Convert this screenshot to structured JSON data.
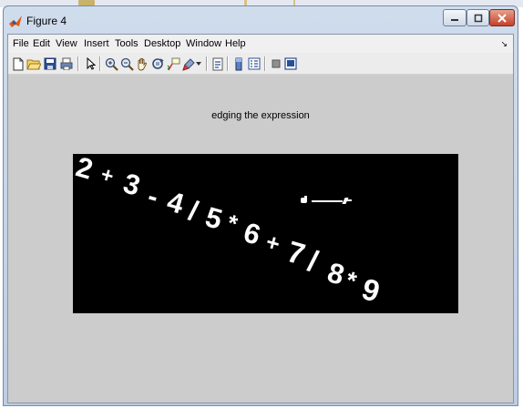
{
  "window": {
    "title": "Figure 4"
  },
  "menu": {
    "items": [
      "File",
      "Edit",
      "View",
      "Insert",
      "Tools",
      "Desktop",
      "Window",
      "Help"
    ],
    "overflow_arrow": "↘"
  },
  "toolbar": {
    "icons": [
      "new-figure-icon",
      "open-file-icon",
      "save-icon",
      "print-icon",
      "pointer-icon",
      "zoom-in-icon",
      "zoom-out-icon",
      "pan-hand-icon",
      "rotate-3d-icon",
      "data-cursor-icon",
      "brush-icon",
      "brush-dropdown-icon",
      "link-plot-icon",
      "colorbar-icon",
      "legend-icon",
      "hide-plot-tools-icon",
      "show-plot-tools-icon"
    ]
  },
  "figure": {
    "title": "edging the expression",
    "expression_chars": [
      "2",
      "+",
      "3",
      "-",
      "4",
      "/",
      "5",
      "*",
      "6",
      "+",
      "7",
      "/",
      "8",
      "*",
      "9"
    ],
    "background_color": "#cccccc",
    "axes_color": "#000000",
    "ink_color": "#ffffff"
  }
}
